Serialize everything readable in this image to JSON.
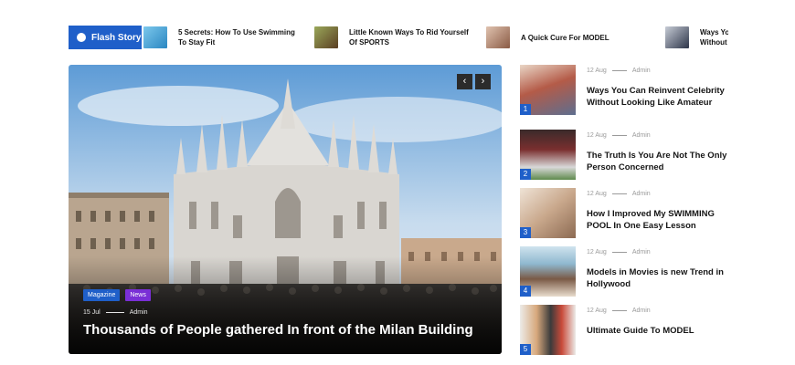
{
  "ticker": {
    "label": "Flash Story",
    "items": [
      {
        "title": "5 Secrets: How To Use Swimming To Stay Fit",
        "thumb_color": "#4aa3d6"
      },
      {
        "title": "Little Known Ways To Rid Yourself Of SPORTS",
        "thumb_color": "#6f8a3a"
      },
      {
        "title": "A Quick Cure For MODEL",
        "thumb_color": "#b98f7c"
      },
      {
        "title": "Ways Yo Without",
        "thumb_color": "#3b4a64"
      }
    ]
  },
  "hero": {
    "tags": [
      "Magazine",
      "News"
    ],
    "date": "15 Jul",
    "author": "Admin",
    "title": "Thousands of People gathered In front of the Milan Building",
    "prev_icon": "‹",
    "next_icon": "›"
  },
  "side": {
    "items": [
      {
        "num": "1",
        "date": "12 Aug",
        "author": "Admin",
        "title": "Ways You Can Reinvent Celebrity Without Looking Like Amateur",
        "thumb_color": "#b45b48"
      },
      {
        "num": "2",
        "date": "12 Aug",
        "author": "Admin",
        "title": "The Truth Is You Are Not The Only Person Concerned",
        "thumb_color": "#6e3a3a"
      },
      {
        "num": "3",
        "date": "12 Aug",
        "author": "Admin",
        "title": "How I Improved My SWIMMING POOL In One Easy Lesson",
        "thumb_color": "#c9a88c"
      },
      {
        "num": "4",
        "date": "12 Aug",
        "author": "Admin",
        "title": "Models in Movies is new Trend in Hollywood",
        "thumb_color": "#8fb8cf"
      },
      {
        "num": "5",
        "date": "12 Aug",
        "author": "Admin",
        "title": "Ultimate Guide To MODEL",
        "thumb_color": "#d7d2cc"
      }
    ]
  },
  "colors": {
    "accent": "#1f5fc9",
    "news_tag": "#7a2fd6"
  }
}
